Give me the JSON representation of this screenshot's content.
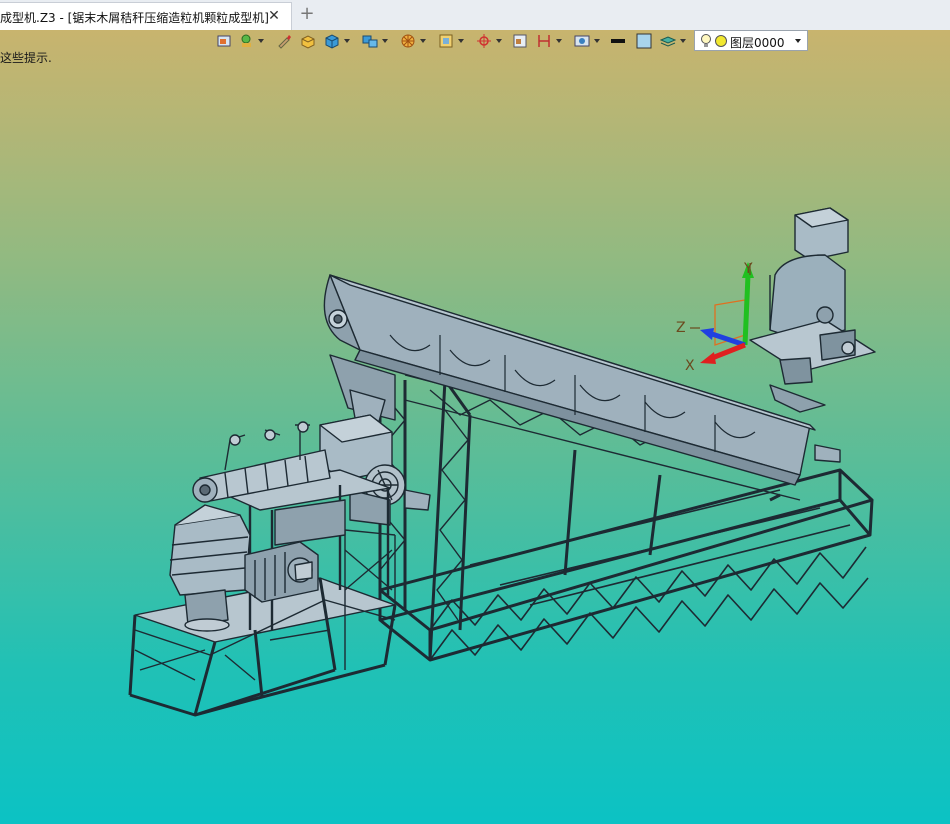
{
  "tab": {
    "title": "成型机.Z3 - [锯末木屑秸秆压缩造粒机颗粒成型机]",
    "close_glyph": "✕",
    "new_glyph": "+"
  },
  "viewport": {
    "hint": "这些提示."
  },
  "toolbar": {
    "items": [
      "view-icon",
      "paint-icon",
      "brush-icon",
      "box-icon",
      "cube-icon",
      "cube-stack-icon",
      "wheel-icon",
      "frame-icon",
      "crosshair-icon",
      "display-icon",
      "dimension-icon",
      "filter-icon",
      "line-style-icon",
      "color-icon",
      "layer-stack-icon"
    ],
    "layer_label": "图层0000"
  },
  "triad": {
    "x": "X",
    "y": "Y",
    "z": "Z"
  },
  "colors": {
    "model_fill": "#9fb1bd",
    "model_stroke": "#1d2a33",
    "x_axis": "#e02020",
    "y_axis": "#20c020",
    "z_axis": "#2040e0"
  }
}
